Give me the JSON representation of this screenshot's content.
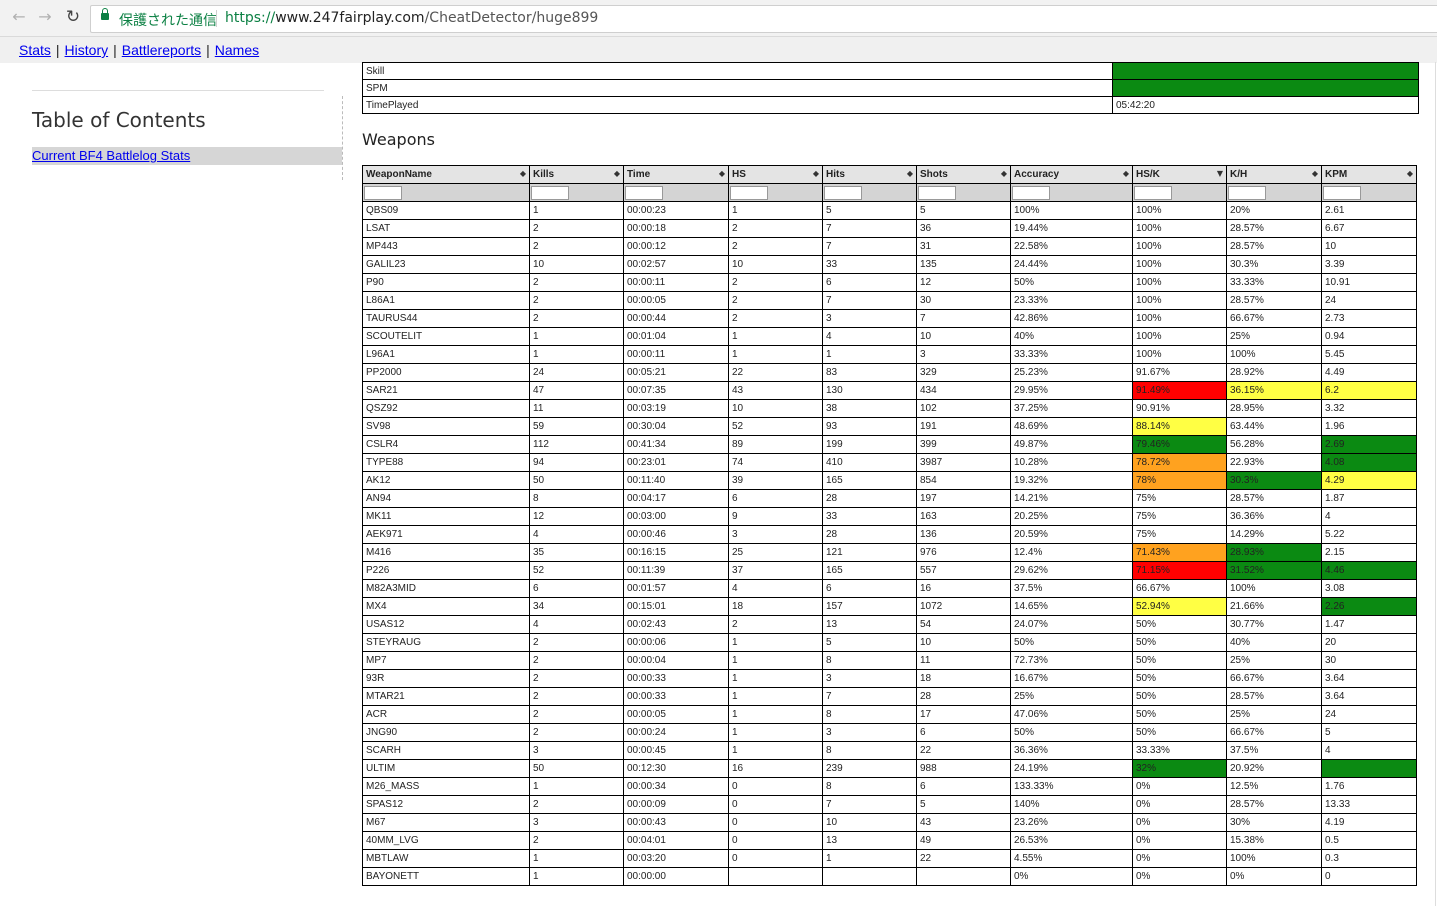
{
  "browser": {
    "secure_label": "保護された通信",
    "url_scheme": "https://",
    "url_host": "www.247fairplay.com",
    "url_path": "/CheatDetector/huge899",
    "icons": [
      "back-arrow-icon",
      "forward-arrow-icon",
      "reload-icon",
      "lock-icon"
    ]
  },
  "topnav": {
    "items": [
      "Stats",
      "History",
      "Battlereports",
      "Names"
    ],
    "separator": "|"
  },
  "sidebar": {
    "toc_title": "Table of Contents",
    "toc_link": "Current BF4 Battlelog Stats"
  },
  "summary": {
    "rows": [
      {
        "label": "Skill",
        "value": "",
        "color": "#0b8a12"
      },
      {
        "label": "SPM",
        "value": "",
        "color": "#0b8a12"
      },
      {
        "label": "TimePlayed",
        "value": "05:42:20",
        "color": ""
      }
    ]
  },
  "weapons_heading": "Weapons",
  "weapons": {
    "columns": [
      "WeaponName",
      "Kills",
      "Time",
      "HS",
      "Hits",
      "Shots",
      "Accuracy",
      "HS/K",
      "K/H",
      "KPM"
    ],
    "sorted_column": "HS/K",
    "sort_icons": {
      "default": "◆",
      "sorted": "▼"
    },
    "rows": [
      {
        "cells": [
          "QBS09",
          "1",
          "00:00:23",
          "1",
          "5",
          "5",
          "100%",
          "100%",
          "20%",
          "2.61"
        ]
      },
      {
        "cells": [
          "LSAT",
          "2",
          "00:00:18",
          "2",
          "7",
          "36",
          "19.44%",
          "100%",
          "28.57%",
          "6.67"
        ]
      },
      {
        "cells": [
          "MP443",
          "2",
          "00:00:12",
          "2",
          "7",
          "31",
          "22.58%",
          "100%",
          "28.57%",
          "10"
        ]
      },
      {
        "cells": [
          "GALIL23",
          "10",
          "00:02:57",
          "10",
          "33",
          "135",
          "24.44%",
          "100%",
          "30.3%",
          "3.39"
        ]
      },
      {
        "cells": [
          "P90",
          "2",
          "00:00:11",
          "2",
          "6",
          "12",
          "50%",
          "100%",
          "33.33%",
          "10.91"
        ]
      },
      {
        "cells": [
          "L86A1",
          "2",
          "00:00:05",
          "2",
          "7",
          "30",
          "23.33%",
          "100%",
          "28.57%",
          "24"
        ]
      },
      {
        "cells": [
          "TAURUS44",
          "2",
          "00:00:44",
          "2",
          "3",
          "7",
          "42.86%",
          "100%",
          "66.67%",
          "2.73"
        ]
      },
      {
        "cells": [
          "SCOUTELIT",
          "1",
          "00:01:04",
          "1",
          "4",
          "10",
          "40%",
          "100%",
          "25%",
          "0.94"
        ]
      },
      {
        "cells": [
          "L96A1",
          "1",
          "00:00:11",
          "1",
          "1",
          "3",
          "33.33%",
          "100%",
          "100%",
          "5.45"
        ]
      },
      {
        "cells": [
          "PP2000",
          "24",
          "00:05:21",
          "22",
          "83",
          "329",
          "25.23%",
          "91.67%",
          "28.92%",
          "4.49"
        ]
      },
      {
        "cells": [
          "SAR21",
          "47",
          "00:07:35",
          "43",
          "130",
          "434",
          "29.95%",
          "91.49%",
          "36.15%",
          "6.2"
        ],
        "colors": {
          "7": "red",
          "8": "yellow",
          "9": "yellow"
        }
      },
      {
        "cells": [
          "QSZ92",
          "11",
          "00:03:19",
          "10",
          "38",
          "102",
          "37.25%",
          "90.91%",
          "28.95%",
          "3.32"
        ]
      },
      {
        "cells": [
          "SV98",
          "59",
          "00:30:04",
          "52",
          "93",
          "191",
          "48.69%",
          "88.14%",
          "63.44%",
          "1.96"
        ],
        "colors": {
          "7": "yellow"
        }
      },
      {
        "cells": [
          "CSLR4",
          "112",
          "00:41:34",
          "89",
          "199",
          "399",
          "49.87%",
          "79.46%",
          "56.28%",
          "2.69"
        ],
        "colors": {
          "7": "green",
          "9": "green"
        }
      },
      {
        "cells": [
          "TYPE88",
          "94",
          "00:23:01",
          "74",
          "410",
          "3987",
          "10.28%",
          "78.72%",
          "22.93%",
          "4.08"
        ],
        "colors": {
          "7": "orange",
          "9": "green"
        }
      },
      {
        "cells": [
          "AK12",
          "50",
          "00:11:40",
          "39",
          "165",
          "854",
          "19.32%",
          "78%",
          "30.3%",
          "4.29"
        ],
        "colors": {
          "7": "orange",
          "8": "green",
          "9": "yellow"
        }
      },
      {
        "cells": [
          "AN94",
          "8",
          "00:04:17",
          "6",
          "28",
          "197",
          "14.21%",
          "75%",
          "28.57%",
          "1.87"
        ]
      },
      {
        "cells": [
          "MK11",
          "12",
          "00:03:00",
          "9",
          "33",
          "163",
          "20.25%",
          "75%",
          "36.36%",
          "4"
        ]
      },
      {
        "cells": [
          "AEK971",
          "4",
          "00:00:46",
          "3",
          "28",
          "136",
          "20.59%",
          "75%",
          "14.29%",
          "5.22"
        ]
      },
      {
        "cells": [
          "M416",
          "35",
          "00:16:15",
          "25",
          "121",
          "976",
          "12.4%",
          "71.43%",
          "28.93%",
          "2.15"
        ],
        "colors": {
          "7": "orange",
          "8": "green"
        }
      },
      {
        "cells": [
          "P226",
          "52",
          "00:11:39",
          "37",
          "165",
          "557",
          "29.62%",
          "71.15%",
          "31.52%",
          "4.46"
        ],
        "colors": {
          "7": "red",
          "8": "green",
          "9": "green"
        }
      },
      {
        "cells": [
          "M82A3MID",
          "6",
          "00:01:57",
          "4",
          "6",
          "16",
          "37.5%",
          "66.67%",
          "100%",
          "3.08"
        ]
      },
      {
        "cells": [
          "MX4",
          "34",
          "00:15:01",
          "18",
          "157",
          "1072",
          "14.65%",
          "52.94%",
          "21.66%",
          "2.26"
        ],
        "colors": {
          "7": "yellow",
          "9": "green"
        }
      },
      {
        "cells": [
          "USAS12",
          "4",
          "00:02:43",
          "2",
          "13",
          "54",
          "24.07%",
          "50%",
          "30.77%",
          "1.47"
        ]
      },
      {
        "cells": [
          "STEYRAUG",
          "2",
          "00:00:06",
          "1",
          "5",
          "10",
          "50%",
          "50%",
          "40%",
          "20"
        ]
      },
      {
        "cells": [
          "MP7",
          "2",
          "00:00:04",
          "1",
          "8",
          "11",
          "72.73%",
          "50%",
          "25%",
          "30"
        ]
      },
      {
        "cells": [
          "93R",
          "2",
          "00:00:33",
          "1",
          "3",
          "18",
          "16.67%",
          "50%",
          "66.67%",
          "3.64"
        ]
      },
      {
        "cells": [
          "MTAR21",
          "2",
          "00:00:33",
          "1",
          "7",
          "28",
          "25%",
          "50%",
          "28.57%",
          "3.64"
        ]
      },
      {
        "cells": [
          "ACR",
          "2",
          "00:00:05",
          "1",
          "8",
          "17",
          "47.06%",
          "50%",
          "25%",
          "24"
        ]
      },
      {
        "cells": [
          "JNG90",
          "2",
          "00:00:24",
          "1",
          "3",
          "6",
          "50%",
          "50%",
          "66.67%",
          "5"
        ]
      },
      {
        "cells": [
          "SCARH",
          "3",
          "00:00:45",
          "1",
          "8",
          "22",
          "36.36%",
          "33.33%",
          "37.5%",
          "4"
        ]
      },
      {
        "cells": [
          "ULTIM",
          "50",
          "00:12:30",
          "16",
          "239",
          "988",
          "24.19%",
          "32%",
          "20.92%",
          ""
        ],
        "colors": {
          "7": "green",
          "9": "green"
        }
      },
      {
        "cells": [
          "M26_MASS",
          "1",
          "00:00:34",
          "0",
          "8",
          "6",
          "133.33%",
          "0%",
          "12.5%",
          "1.76"
        ]
      },
      {
        "cells": [
          "SPAS12",
          "2",
          "00:00:09",
          "0",
          "7",
          "5",
          "140%",
          "0%",
          "28.57%",
          "13.33"
        ]
      },
      {
        "cells": [
          "M67",
          "3",
          "00:00:43",
          "0",
          "10",
          "43",
          "23.26%",
          "0%",
          "30%",
          "4.19"
        ]
      },
      {
        "cells": [
          "40MM_LVG",
          "2",
          "00:04:01",
          "0",
          "13",
          "49",
          "26.53%",
          "0%",
          "15.38%",
          "0.5"
        ]
      },
      {
        "cells": [
          "MBTLAW",
          "1",
          "00:03:20",
          "0",
          "1",
          "22",
          "4.55%",
          "0%",
          "100%",
          "0.3"
        ]
      },
      {
        "cells": [
          "BAYONETT",
          "1",
          "00:00:00",
          "",
          "",
          "",
          "0%",
          "0%",
          "0%",
          "0"
        ]
      }
    ]
  },
  "colors": {
    "red": "#ff0000",
    "orange": "#ffa21f",
    "yellow": "#ffff44",
    "green": "#0b8a12",
    "link": "#0000ee"
  }
}
